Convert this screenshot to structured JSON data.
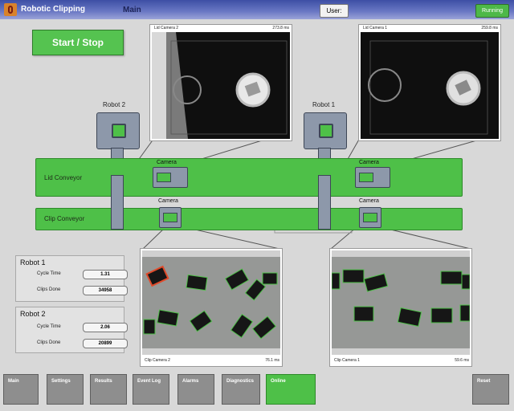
{
  "header": {
    "app_title": "Robotic Clipping",
    "screen": "Main",
    "user_button": "User:",
    "status": "Running"
  },
  "start_stop": "Start / Stop",
  "cameras": {
    "lid2": {
      "name": "Lid Camera 2",
      "time": "273.8 ms"
    },
    "lid1": {
      "name": "Lid Camera 1",
      "time": "259.8 ms"
    },
    "clip2": {
      "name": "Clip Camera 2",
      "time": "76.1 ms"
    },
    "clip1": {
      "name": "Clip Camera 1",
      "time": "59.6 ms"
    }
  },
  "robots": {
    "robot2": "Robot 2",
    "robot1": "Robot 1"
  },
  "conveyors": {
    "lid": "Lid Conveyor",
    "clip": "Clip Conveyor"
  },
  "camera_label": "Camera",
  "stats": {
    "robot1": {
      "title": "Robot 1",
      "cycle_label": "Cycle Time",
      "cycle_value": "1.31",
      "clips_label": "Clips Done",
      "clips_value": "34958"
    },
    "robot2": {
      "title": "Robot 2",
      "cycle_label": "Cycle Time",
      "cycle_value": "2.06",
      "clips_label": "Clips Done",
      "clips_value": "20899"
    }
  },
  "nav": [
    "Main",
    "Settings",
    "Results",
    "Event Log",
    "Alarms",
    "Diagnostics",
    "Online",
    "Reset"
  ],
  "colors": {
    "accent_green": "#4ec048",
    "title_bar": "#3d4fa5",
    "machine_gray": "#8d98aa",
    "detect_red": "#e04a2a"
  }
}
